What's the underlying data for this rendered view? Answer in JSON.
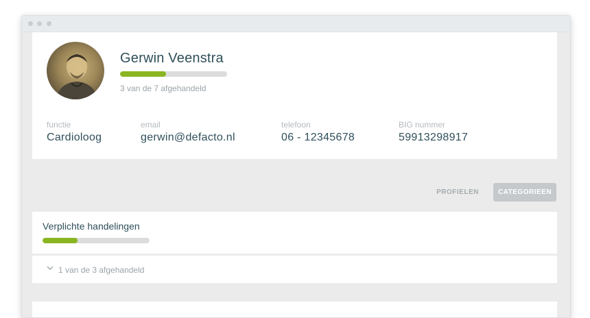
{
  "window": {
    "dots": [
      "dot",
      "dot",
      "dot"
    ]
  },
  "profile": {
    "name": "Gerwin Veenstra",
    "progress_value": 0.43,
    "progress_text": "3 van de 7 afgehandeld",
    "fields": {
      "functie": {
        "label": "functie",
        "value": "Cardioloog"
      },
      "email": {
        "label": "email",
        "value": "gerwin@defacto.nl"
      },
      "telefoon": {
        "label": "telefoon",
        "value": "06 - 12345678"
      },
      "big": {
        "label": "BIG nummer",
        "value": "59913298917"
      }
    }
  },
  "tabs": {
    "profielen": "PROFIELEN",
    "categorieen": "CATEGORIEEN",
    "active": "categorieen"
  },
  "category": {
    "title": "Verplichte handelingen",
    "progress_value": 0.33,
    "summary": "1 van de 3 afgehandeld"
  },
  "colors": {
    "accent": "#8ab522",
    "text_dark": "#2f4f5a",
    "muted": "#9aa3a8"
  }
}
